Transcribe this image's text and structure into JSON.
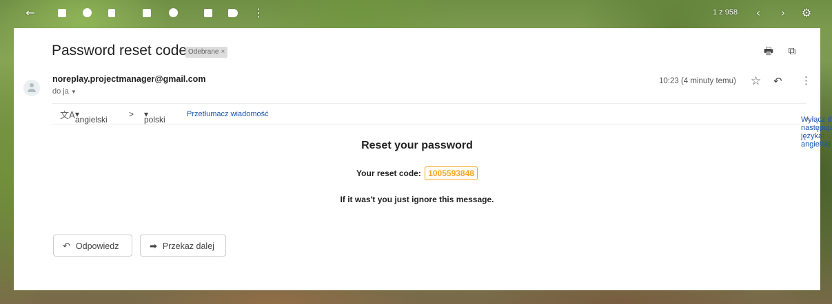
{
  "toolbar": {
    "icons": [
      "back-arrow-icon",
      "archive-icon",
      "report-spam-icon",
      "delete-icon",
      "mark-unread-icon",
      "snooze-icon",
      "move-to-icon",
      "label-icon",
      "more-icon",
      "older-icon",
      "newer-icon",
      "settings-icon"
    ],
    "counter": "1 z 958"
  },
  "message": {
    "subject": "Password reset code.",
    "label": "Odebrane",
    "label_close": "×",
    "sender": "noreplay.projectmanager@gmail.com",
    "to": "do ja",
    "time": "10:23 (4 minuty temu)"
  },
  "translate": {
    "from_lang": "angielski",
    "arrow": ">",
    "to_lang": "polski",
    "translate_link": "Przetłumacz wiadomość",
    "turn_off": "Wyłącz dla następującego języka: angielski",
    "close": "×"
  },
  "body": {
    "title": "Reset your password",
    "code_label": "Your reset code:",
    "code_value": "1005593848",
    "ignore_text": "If it was't you just ignore this message."
  },
  "actions": {
    "reply_label": "Odpowiedz",
    "forward_label": "Przekaz dalej"
  }
}
